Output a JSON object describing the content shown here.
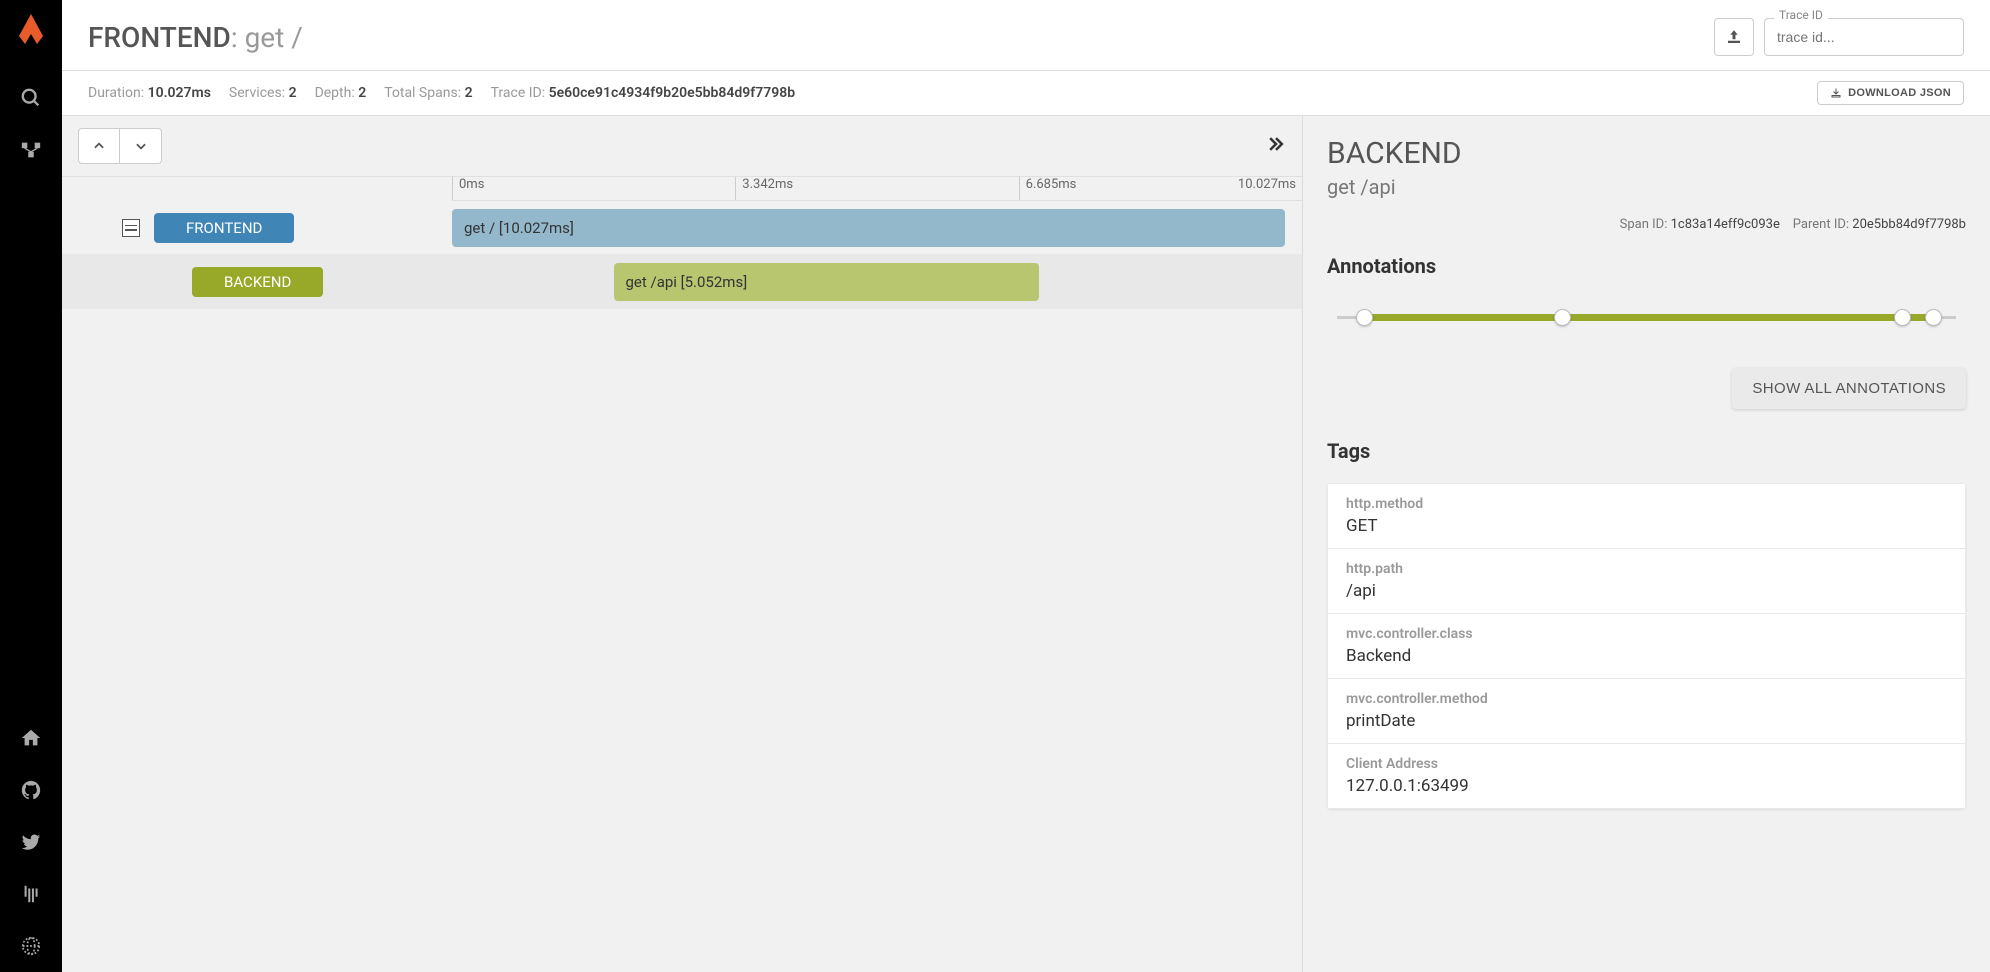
{
  "header": {
    "service": "FRONTEND",
    "operation": "get /",
    "trace_id_label": "Trace ID",
    "trace_id_placeholder": "trace id..."
  },
  "stats": {
    "duration_label": "Duration:",
    "duration_value": "10.027ms",
    "services_label": "Services:",
    "services_value": "2",
    "depth_label": "Depth:",
    "depth_value": "2",
    "total_spans_label": "Total Spans:",
    "total_spans_value": "2",
    "trace_id_label": "Trace ID:",
    "trace_id_value": "5e60ce91c4934f9b20e5bb84d9f7798b",
    "download_label": "DOWNLOAD JSON"
  },
  "ruler": {
    "t0": "0ms",
    "t1": "3.342ms",
    "t2": "6.685ms",
    "t3": "10.027ms"
  },
  "spans": {
    "row0_service": "FRONTEND",
    "row0_label": "get / [10.027ms]",
    "row1_service": "BACKEND",
    "row1_label": "get /api [5.052ms]"
  },
  "detail": {
    "title": "BACKEND",
    "subtitle": "get /api",
    "span_id_label": "Span ID:",
    "span_id_value": "1c83a14eff9c093e",
    "parent_id_label": "Parent ID:",
    "parent_id_value": "20e5bb84d9f7798b",
    "annotations_heading": "Annotations",
    "show_all_label": "SHOW ALL ANNOTATIONS",
    "tags_heading": "Tags",
    "tags": [
      {
        "key": "http.method",
        "value": "GET"
      },
      {
        "key": "http.path",
        "value": "/api"
      },
      {
        "key": "mvc.controller.class",
        "value": "Backend"
      },
      {
        "key": "mvc.controller.method",
        "value": "printDate"
      },
      {
        "key": "Client Address",
        "value": "127.0.0.1:63499"
      }
    ]
  }
}
